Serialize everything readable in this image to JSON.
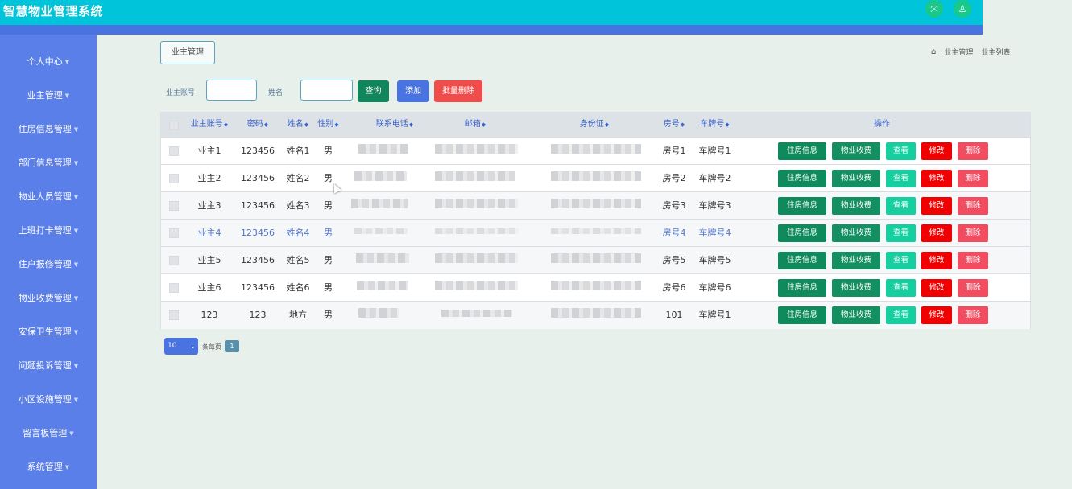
{
  "app": {
    "title": "智慧物业管理系统"
  },
  "header_icons": [
    {
      "icon": "fullscreen-icon",
      "glyph": "⤧"
    },
    {
      "icon": "user-icon",
      "glyph": "♙"
    }
  ],
  "sidebar": {
    "items": [
      {
        "label": "个人中心"
      },
      {
        "label": "业主管理"
      },
      {
        "label": "住房信息管理"
      },
      {
        "label": "部门信息管理"
      },
      {
        "label": "物业人员管理"
      },
      {
        "label": "上班打卡管理"
      },
      {
        "label": "住户报修管理"
      },
      {
        "label": "物业收费管理"
      },
      {
        "label": "安保卫生管理"
      },
      {
        "label": "问题投诉管理"
      },
      {
        "label": "小区设施管理"
      },
      {
        "label": "留言板管理"
      },
      {
        "label": "系统管理"
      }
    ]
  },
  "page": {
    "tag": "业主管理"
  },
  "breadcrumb": {
    "home": "⌂",
    "level1": "业主管理",
    "level2": "业主列表"
  },
  "search": {
    "account_label": "业主账号",
    "account_value": "",
    "name_label": "姓名",
    "name_value": "",
    "query_button": "查询",
    "add_button": "添加",
    "batch_delete_button": "批量删除"
  },
  "table": {
    "headers": [
      "业主账号",
      "密码",
      "姓名",
      "性别",
      "联系电话",
      "邮箱",
      "身份证",
      "房号",
      "车牌号",
      "操作"
    ],
    "rows": [
      {
        "account": "业主1",
        "password": "123456",
        "name": "姓名1",
        "gender": "男",
        "room": "房号1",
        "plate": "车牌号1"
      },
      {
        "account": "业主2",
        "password": "123456",
        "name": "姓名2",
        "gender": "男",
        "room": "房号2",
        "plate": "车牌号2"
      },
      {
        "account": "业主3",
        "password": "123456",
        "name": "姓名3",
        "gender": "男",
        "room": "房号3",
        "plate": "车牌号3"
      },
      {
        "account": "业主4",
        "password": "123456",
        "name": "姓名4",
        "gender": "男",
        "room": "房号4",
        "plate": "车牌号4"
      },
      {
        "account": "业主5",
        "password": "123456",
        "name": "姓名5",
        "gender": "男",
        "room": "房号5",
        "plate": "车牌号5"
      },
      {
        "account": "业主6",
        "password": "123456",
        "name": "姓名6",
        "gender": "男",
        "room": "房号6",
        "plate": "车牌号6"
      },
      {
        "account": "123",
        "password": "123",
        "name": "地方",
        "gender": "男",
        "room": "101",
        "plate": "车牌号1"
      }
    ],
    "actions": {
      "housing": "住房信息",
      "fee": "物业收费",
      "view": "查看",
      "edit": "修改",
      "delete": "删除"
    }
  },
  "pagination": {
    "page_size": "10",
    "per_page_label": "条每页",
    "current_page": "1"
  },
  "colors": {
    "topbar": "#00c4d9",
    "sidebar": "#5a7fe8",
    "query": "#11865c",
    "add": "#4a73e2",
    "batch_delete": "#ef4c4c",
    "housing": "#0f8a5c",
    "fee": "#138f62",
    "view": "#16cfa0",
    "edit": "#f00000",
    "delete": "#f24c61"
  }
}
